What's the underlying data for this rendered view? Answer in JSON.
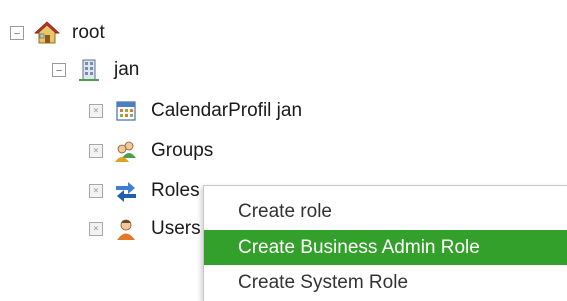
{
  "tree": {
    "root": {
      "label": "root",
      "toggle": "−",
      "icon": "home-icon"
    },
    "user": {
      "label": "jan",
      "toggle": "−",
      "icon": "building-icon"
    },
    "children": [
      {
        "label": "CalendarProfil jan",
        "toggle": "×",
        "icon": "calendar-icon"
      },
      {
        "label": "Groups",
        "toggle": "×",
        "icon": "group-icon"
      },
      {
        "label": "Roles",
        "toggle": "×",
        "icon": "roles-arrows-icon"
      },
      {
        "label": "Users",
        "toggle": "×",
        "icon": "user-icon"
      }
    ]
  },
  "context_menu": {
    "items": [
      {
        "label": "Create role",
        "highlighted": false
      },
      {
        "label": "Create Business Admin Role",
        "highlighted": true
      },
      {
        "label": "Create System Role",
        "highlighted": false
      }
    ],
    "highlight_color": "#34a02c"
  }
}
